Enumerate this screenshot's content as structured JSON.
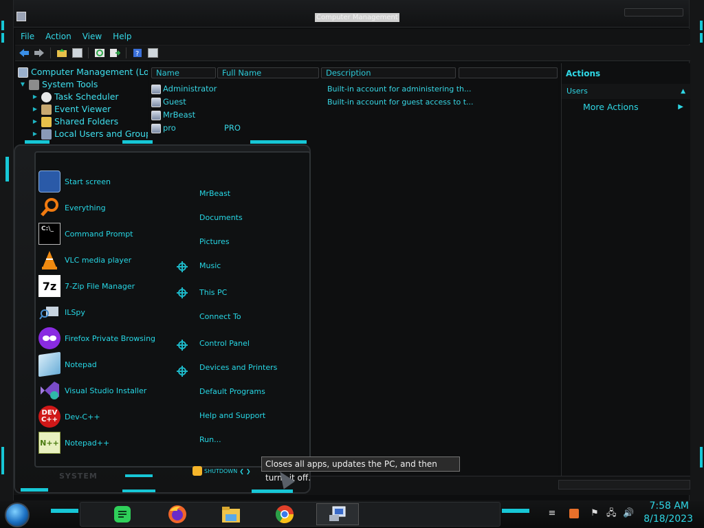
{
  "window": {
    "title": "Computer Management"
  },
  "menu": [
    "File",
    "Action",
    "View",
    "Help"
  ],
  "toolbar": {
    "icons": [
      "back-arrow-icon",
      "forward-arrow-icon",
      "up-folder-icon",
      "show-hide-tree-icon",
      "refresh-icon",
      "export-list-icon",
      "help-icon",
      "properties-icon"
    ]
  },
  "tree": {
    "items": [
      {
        "label": "Computer Management (Local)",
        "icon": "computer-management-icon"
      },
      {
        "label": "System Tools",
        "icon": "tools-icon"
      },
      {
        "label": "Task Scheduler",
        "icon": "clock-icon"
      },
      {
        "label": "Event Viewer",
        "icon": "event-viewer-icon"
      },
      {
        "label": "Shared Folders",
        "icon": "shared-folders-icon"
      },
      {
        "label": "Local Users and Groups",
        "icon": "users-groups-icon"
      }
    ]
  },
  "list": {
    "columns": [
      "Name",
      "Full Name",
      "Description"
    ],
    "rows": [
      {
        "name": "Administrator",
        "full_name": "",
        "description": "Built-in account for administering th..."
      },
      {
        "name": "Guest",
        "full_name": "",
        "description": "Built-in account for guest access to t..."
      },
      {
        "name": "MrBeast",
        "full_name": "",
        "description": ""
      },
      {
        "name": "pro",
        "full_name": "PRO",
        "description": ""
      }
    ]
  },
  "actions": {
    "title": "Actions",
    "section": "Users",
    "more": "More Actions"
  },
  "start_menu": {
    "apps": [
      {
        "label": "Start screen",
        "icon": "start-screen-icon",
        "color": "#2a5aa8"
      },
      {
        "label": "Everything",
        "icon": "search-magnifier-icon",
        "color": "#f07a10"
      },
      {
        "label": "Command Prompt",
        "icon": "terminal-icon",
        "color": "#000000"
      },
      {
        "label": "VLC media player",
        "icon": "vlc-cone-icon",
        "color": "#f08a10"
      },
      {
        "label": "7-Zip File Manager",
        "icon": "7zip-icon",
        "color": "#ffffff"
      },
      {
        "label": "ILSpy",
        "icon": "ilspy-icon",
        "color": "#c8d4e0"
      },
      {
        "label": "Firefox Private Browsing",
        "icon": "private-mask-icon",
        "color": "#8a2be2"
      },
      {
        "label": "Notepad",
        "icon": "notepad-icon",
        "color": "#9cc8e0"
      },
      {
        "label": "Visual Studio Installer",
        "icon": "visual-studio-icon",
        "color": "#7a4cc8"
      },
      {
        "label": "Dev-C++",
        "icon": "devcpp-icon",
        "color": "#d01818"
      },
      {
        "label": "Notepad++",
        "icon": "notepadpp-icon",
        "color": "#e8f0c0"
      }
    ],
    "links": [
      "MrBeast",
      "Documents",
      "Pictures",
      "Music",
      "This PC",
      "Connect To",
      "Control Panel",
      "Devices and Printers",
      "Default Programs",
      "Help and Support",
      "Run..."
    ],
    "system_label": "SYSTEM",
    "shutdown_label": "SHUTDOWN"
  },
  "tooltip": "Closes all apps, updates the PC, and then turns it off.",
  "taskbar": {
    "apps": [
      "notes-app-icon",
      "firefox-icon",
      "file-explorer-icon",
      "chrome-icon",
      "computer-management-icon"
    ],
    "tray": [
      "sound-recorder-icon",
      "flag-icon",
      "network-icon",
      "volume-icon"
    ],
    "time": "7:58 AM",
    "date": "8/18/2023"
  },
  "colors": {
    "accent": "#2fd8e6",
    "background": "#0e0f10",
    "frame": "#151617"
  }
}
